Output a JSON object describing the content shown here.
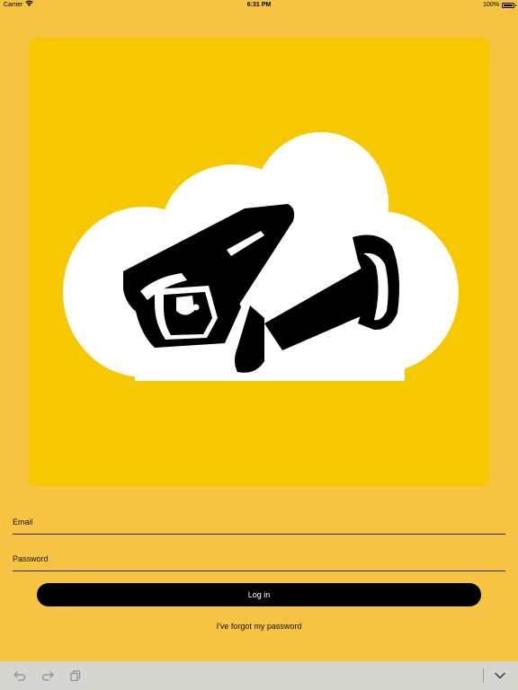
{
  "status_bar": {
    "carrier": "Carrier",
    "time": "6:31 PM",
    "battery_percent": "100%",
    "battery_level": 1.0,
    "wifi_icon": "wifi-icon",
    "battery_icon": "battery-icon"
  },
  "logo": {
    "icon": "cloud-security-camera-icon",
    "panel_color": "#f5c800",
    "cloud_color": "#ffffff",
    "camera_color": "#000000"
  },
  "login_form": {
    "email_placeholder": "Email",
    "email_value": "",
    "password_placeholder": "Password",
    "password_value": "",
    "login_label": "Log in",
    "forgot_password_label": "I've forgot my password"
  },
  "accessory_bar": {
    "undo_icon": "undo-icon",
    "redo_icon": "redo-icon",
    "paste_icon": "paste-icon",
    "dismiss_icon": "chevron-down-icon"
  },
  "colors": {
    "background": "#f6c342",
    "button": "#000000",
    "button_text": "#ffffff",
    "accessory_bar": "#d6d6d0"
  }
}
